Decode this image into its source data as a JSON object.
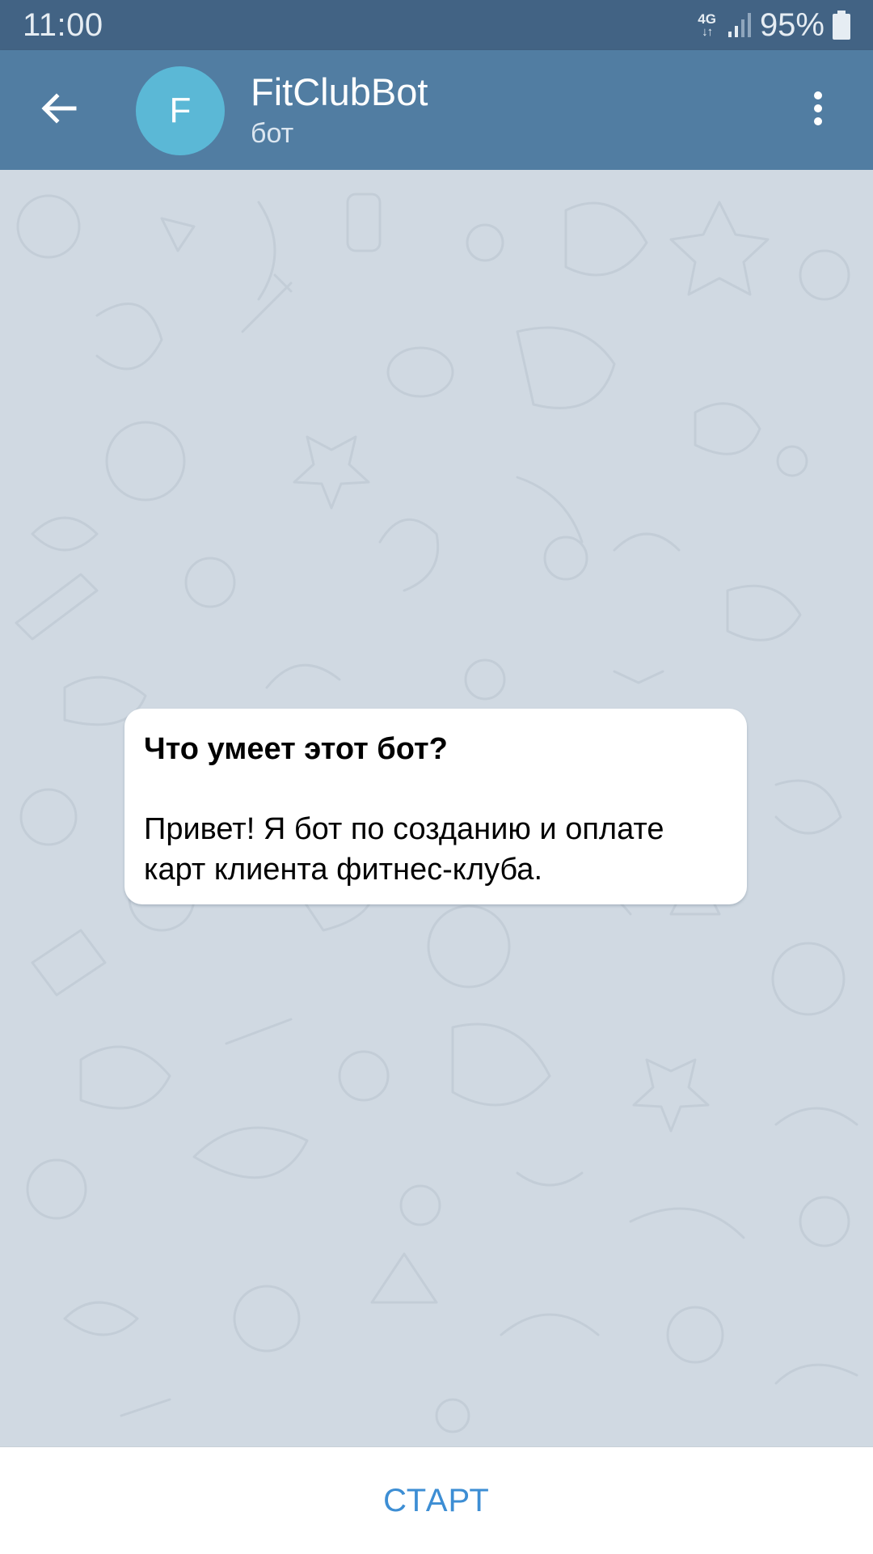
{
  "status_bar": {
    "time": "11:00",
    "network_type": "4G",
    "network_arrows": "↓↑",
    "battery_percent": "95%",
    "icons": [
      "signal-icon",
      "battery-icon"
    ]
  },
  "header": {
    "back_icon": "arrow-left-icon",
    "avatar_letter": "F",
    "avatar_color": "#5bb8d6",
    "title": "FitClubBot",
    "subtitle": "бот",
    "menu_icon": "more-vertical-icon",
    "background_color": "#517da2"
  },
  "chat": {
    "background_color": "#d0d9e2",
    "bot_info": {
      "title": "Что умеет этот бот?",
      "text": "Привет! Я бот по созданию и оплате карт клиента фитнес-клуба."
    }
  },
  "bottom_bar": {
    "start_label": "СТАРТ",
    "accent_color": "#3d8ed4"
  }
}
